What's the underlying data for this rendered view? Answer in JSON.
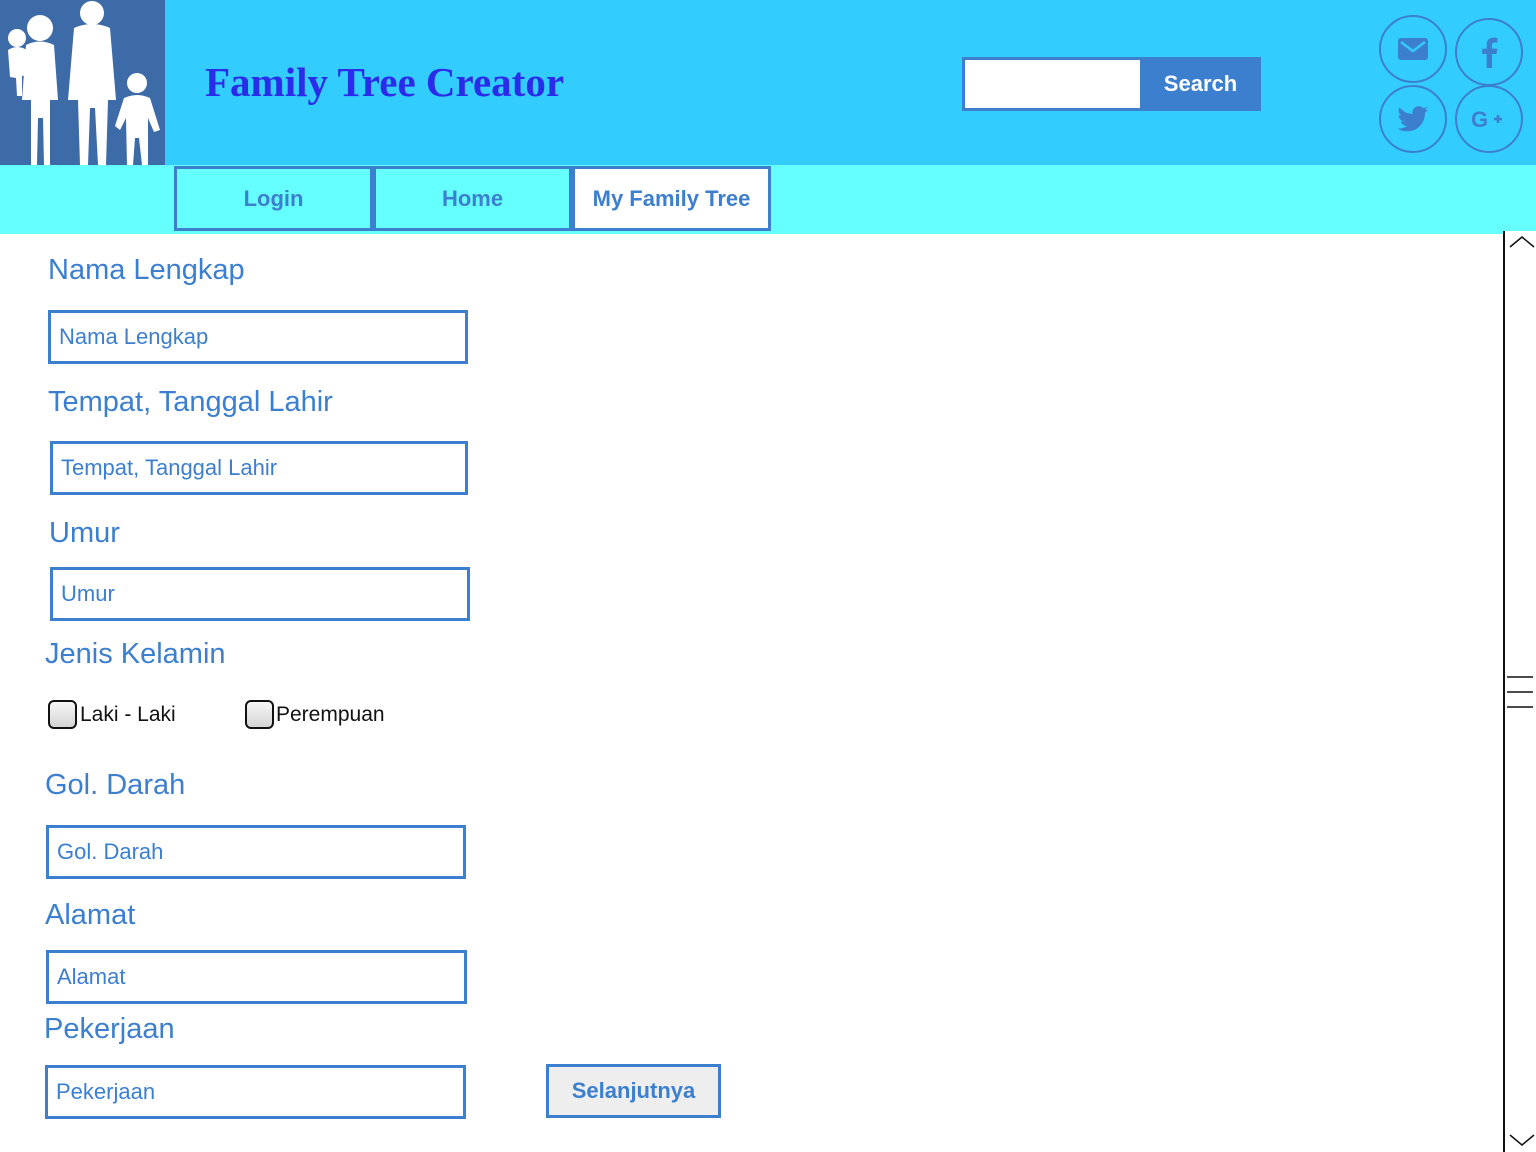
{
  "header": {
    "title": "Family Tree Creator",
    "logo_icon": "family-silhouette-icon",
    "search": {
      "value": "",
      "placeholder": "",
      "button_label": "Search"
    },
    "social_icons": [
      "mail-icon",
      "facebook-icon",
      "twitter-icon",
      "google-plus-icon"
    ]
  },
  "nav": {
    "items": [
      {
        "label": "Login",
        "active": false
      },
      {
        "label": "Home",
        "active": false
      },
      {
        "label": "My Family Tree",
        "active": true
      }
    ]
  },
  "form": {
    "nama": {
      "label": "Nama Lengkap",
      "placeholder": "Nama Lengkap",
      "value": ""
    },
    "ttl": {
      "label": "Tempat, Tanggal Lahir",
      "placeholder": "Tempat, Tanggal Lahir",
      "value": ""
    },
    "umur": {
      "label": "Umur",
      "placeholder": "Umur",
      "value": ""
    },
    "gender": {
      "label": "Jenis Kelamin",
      "options": [
        "Laki - Laki",
        "Perempuan"
      ]
    },
    "goldarah": {
      "label": "Gol. Darah",
      "placeholder": "Gol. Darah",
      "value": ""
    },
    "alamat": {
      "label": "Alamat",
      "placeholder": "Alamat",
      "value": ""
    },
    "pekerjaan": {
      "label": "Pekerjaan",
      "placeholder": "Pekerjaan",
      "value": ""
    },
    "next_label": "Selanjutnya"
  },
  "colors": {
    "header_bg": "#33ccff",
    "nav_bg": "#66ffff",
    "accent": "#3c7fcf",
    "title": "#2b2bea",
    "logo_bg": "#3d6ba8"
  }
}
